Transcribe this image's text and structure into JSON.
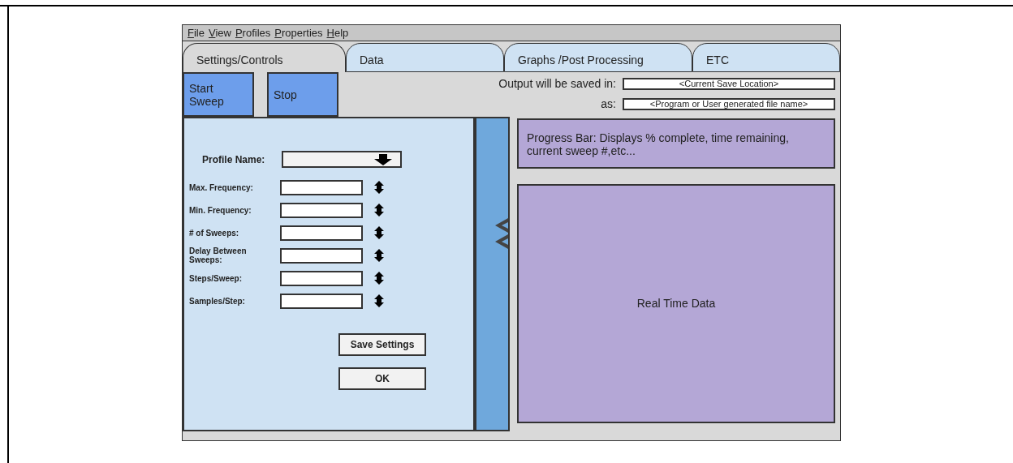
{
  "menu": [
    "File",
    "View",
    "Profiles",
    "Properties",
    "Help"
  ],
  "tabs": [
    {
      "label": "Settings/Controls",
      "selected": true
    },
    {
      "label": "Data",
      "selected": false
    },
    {
      "label": "Graphs /Post Processing",
      "selected": false
    },
    {
      "label": "ETC",
      "selected": false
    }
  ],
  "toolbar": {
    "buttons": [
      "Start Sweep",
      "Stop"
    ],
    "save_in_label": "Output will be saved in:",
    "save_in_value": "<Current Save Location>",
    "save_as_label": "as:",
    "save_as_value": "<Program or User generated file name>"
  },
  "settings": {
    "profile_label": "Profile Name:",
    "fields": [
      {
        "label": "Max. Frequency:"
      },
      {
        "label": "Min. Frequency:"
      },
      {
        "label": "# of Sweeps:"
      },
      {
        "label": "Delay Between Sweeps:"
      },
      {
        "label": "Steps/Sweep:"
      },
      {
        "label": "Samples/Step:"
      }
    ],
    "buttons": [
      "Save Settings",
      "OK"
    ]
  },
  "progress_text": "Progress Bar: Displays % complete, time remaining, current sweep #,etc...",
  "data_panel_text": "Real Time Data"
}
